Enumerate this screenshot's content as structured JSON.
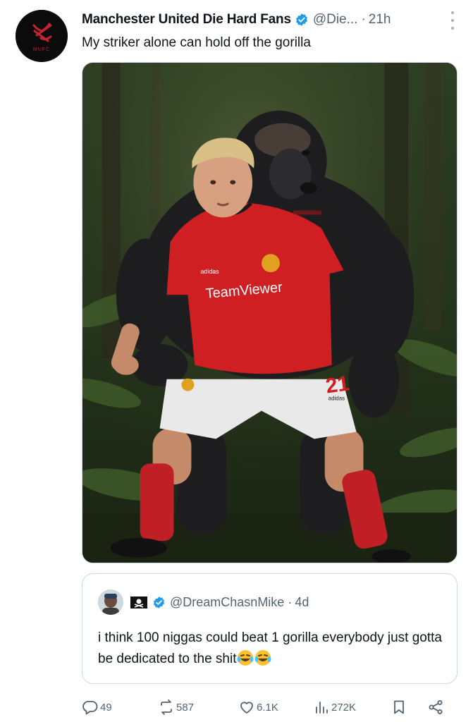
{
  "post": {
    "author_name": "Manchester United Die Hard Fans",
    "author_handle": "@Die...",
    "separator": "·",
    "time": "21h",
    "avatar_text": "MUFC",
    "text": "My striker alone can hold off the gorilla"
  },
  "media": {
    "jersey_sponsor": "TeamViewer",
    "jersey_brand": "adidas",
    "shorts_number": "21",
    "shorts_brand": "adidas"
  },
  "quote": {
    "handle": "@DreamChasnMike",
    "separator": "·",
    "time": "4d",
    "text": "i think 100 niggas could beat 1 gorilla everybody just gotta be dedicated to the shit"
  },
  "actions": {
    "replies": "49",
    "reposts": "587",
    "likes": "6.1K",
    "views": "272K"
  },
  "colors": {
    "verified": "#1d9bf0",
    "secondary_text": "#536471",
    "border": "#cfd9de",
    "jersey_red": "#d01f23"
  }
}
